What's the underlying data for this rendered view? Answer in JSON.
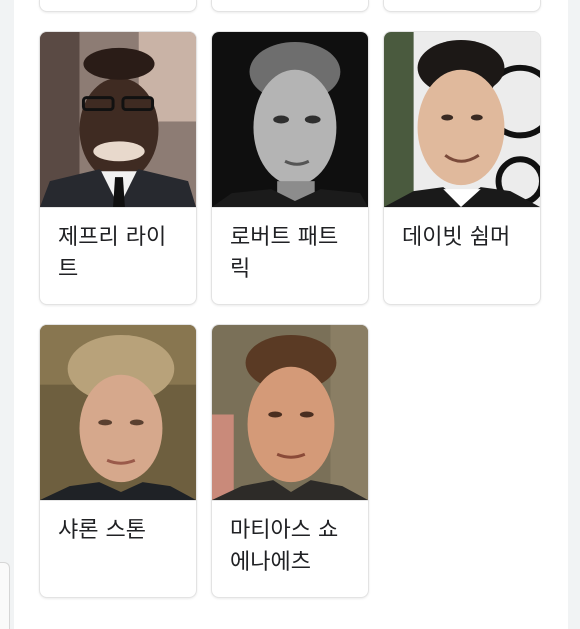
{
  "results": [
    {
      "name": "제프리 라이트",
      "photo": "jeffrey-wright-photo"
    },
    {
      "name": "로버트 패트릭",
      "photo": "robert-patrick-photo"
    },
    {
      "name": "데이빗 쉼머",
      "photo": "david-schwimmer-photo"
    },
    {
      "name": "샤론 스톤",
      "photo": "sharon-stone-photo"
    },
    {
      "name": "마티아스 쇼에나에츠",
      "photo": "matthias-schoenaerts-photo"
    }
  ]
}
